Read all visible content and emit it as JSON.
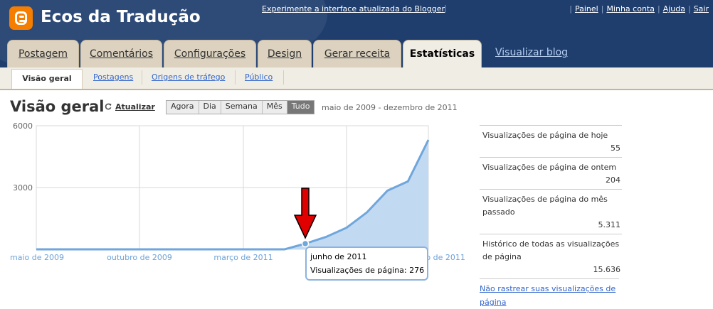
{
  "header": {
    "blog_title": "Ecos da Tradução",
    "try_new": "Experimente a interface atualizada do Blogger",
    "links": [
      "Painel",
      "Minha conta",
      "Ajuda",
      "Sair"
    ]
  },
  "tabs": [
    {
      "label": "Postagem"
    },
    {
      "label": "Comentários"
    },
    {
      "label": "Configurações"
    },
    {
      "label": "Design"
    },
    {
      "label": "Gerar receita"
    },
    {
      "label": "Estatísticas",
      "active": true
    }
  ],
  "view_blog": "Visualizar blog",
  "subnav": {
    "active": "Visão geral",
    "items": [
      "Postagens",
      "Origens de tráfego",
      "Público"
    ]
  },
  "page": {
    "title": "Visão geral",
    "refresh": "Atualizar",
    "ranges": [
      "Agora",
      "Dia",
      "Semana",
      "Mês",
      "Tudo"
    ],
    "selected_range": "Tudo",
    "date_range": "maio de 2009 - dezembro de 2011"
  },
  "chart_data": {
    "type": "area",
    "y_ticks": [
      6000,
      3000
    ],
    "ylim": [
      0,
      6000
    ],
    "x_labels": [
      "maio de 2009",
      "outubro de 2009",
      "março de 2011",
      "agosto de 2011",
      "dezembro de 2011"
    ],
    "series": [
      {
        "values": [
          {
            "x": "maio de 2009",
            "y": 0
          },
          {
            "x": "março de 2011",
            "y": 0
          },
          {
            "x": "abril de 2011",
            "y": 0
          },
          {
            "x": "maio de 2011",
            "y": 0
          },
          {
            "x": "junho de 2011",
            "y": 276
          },
          {
            "x": "julho de 2011",
            "y": 600
          },
          {
            "x": "agosto de 2011",
            "y": 1050
          },
          {
            "x": "setembro de 2011",
            "y": 1800
          },
          {
            "x": "outubro de 2011",
            "y": 2850
          },
          {
            "x": "novembro de 2011",
            "y": 3300
          },
          {
            "x": "dezembro de 2011",
            "y": 5311
          }
        ]
      }
    ],
    "tooltip": {
      "title": "junho de 2011",
      "text": "Visualizações de página: 276"
    },
    "grid": true
  },
  "stats": [
    {
      "label": "Visualizações de página de hoje",
      "value": "55"
    },
    {
      "label": "Visualizações de página de ontem",
      "value": "204"
    },
    {
      "label": "Visualizações de página do mês passado",
      "value": "5.311"
    },
    {
      "label": "Histórico de todas as visualizações de página",
      "value": "15.636"
    }
  ],
  "dont_track": "Não rastrear suas visualizações de página",
  "colors": {
    "header": "#1f3e6e",
    "tab": "#dcd2bf",
    "active_tab": "#f0ede4",
    "area": "#c2d9f2",
    "line": "#6fa6dc",
    "arrow": "#e00000",
    "link": "#3366cc"
  }
}
